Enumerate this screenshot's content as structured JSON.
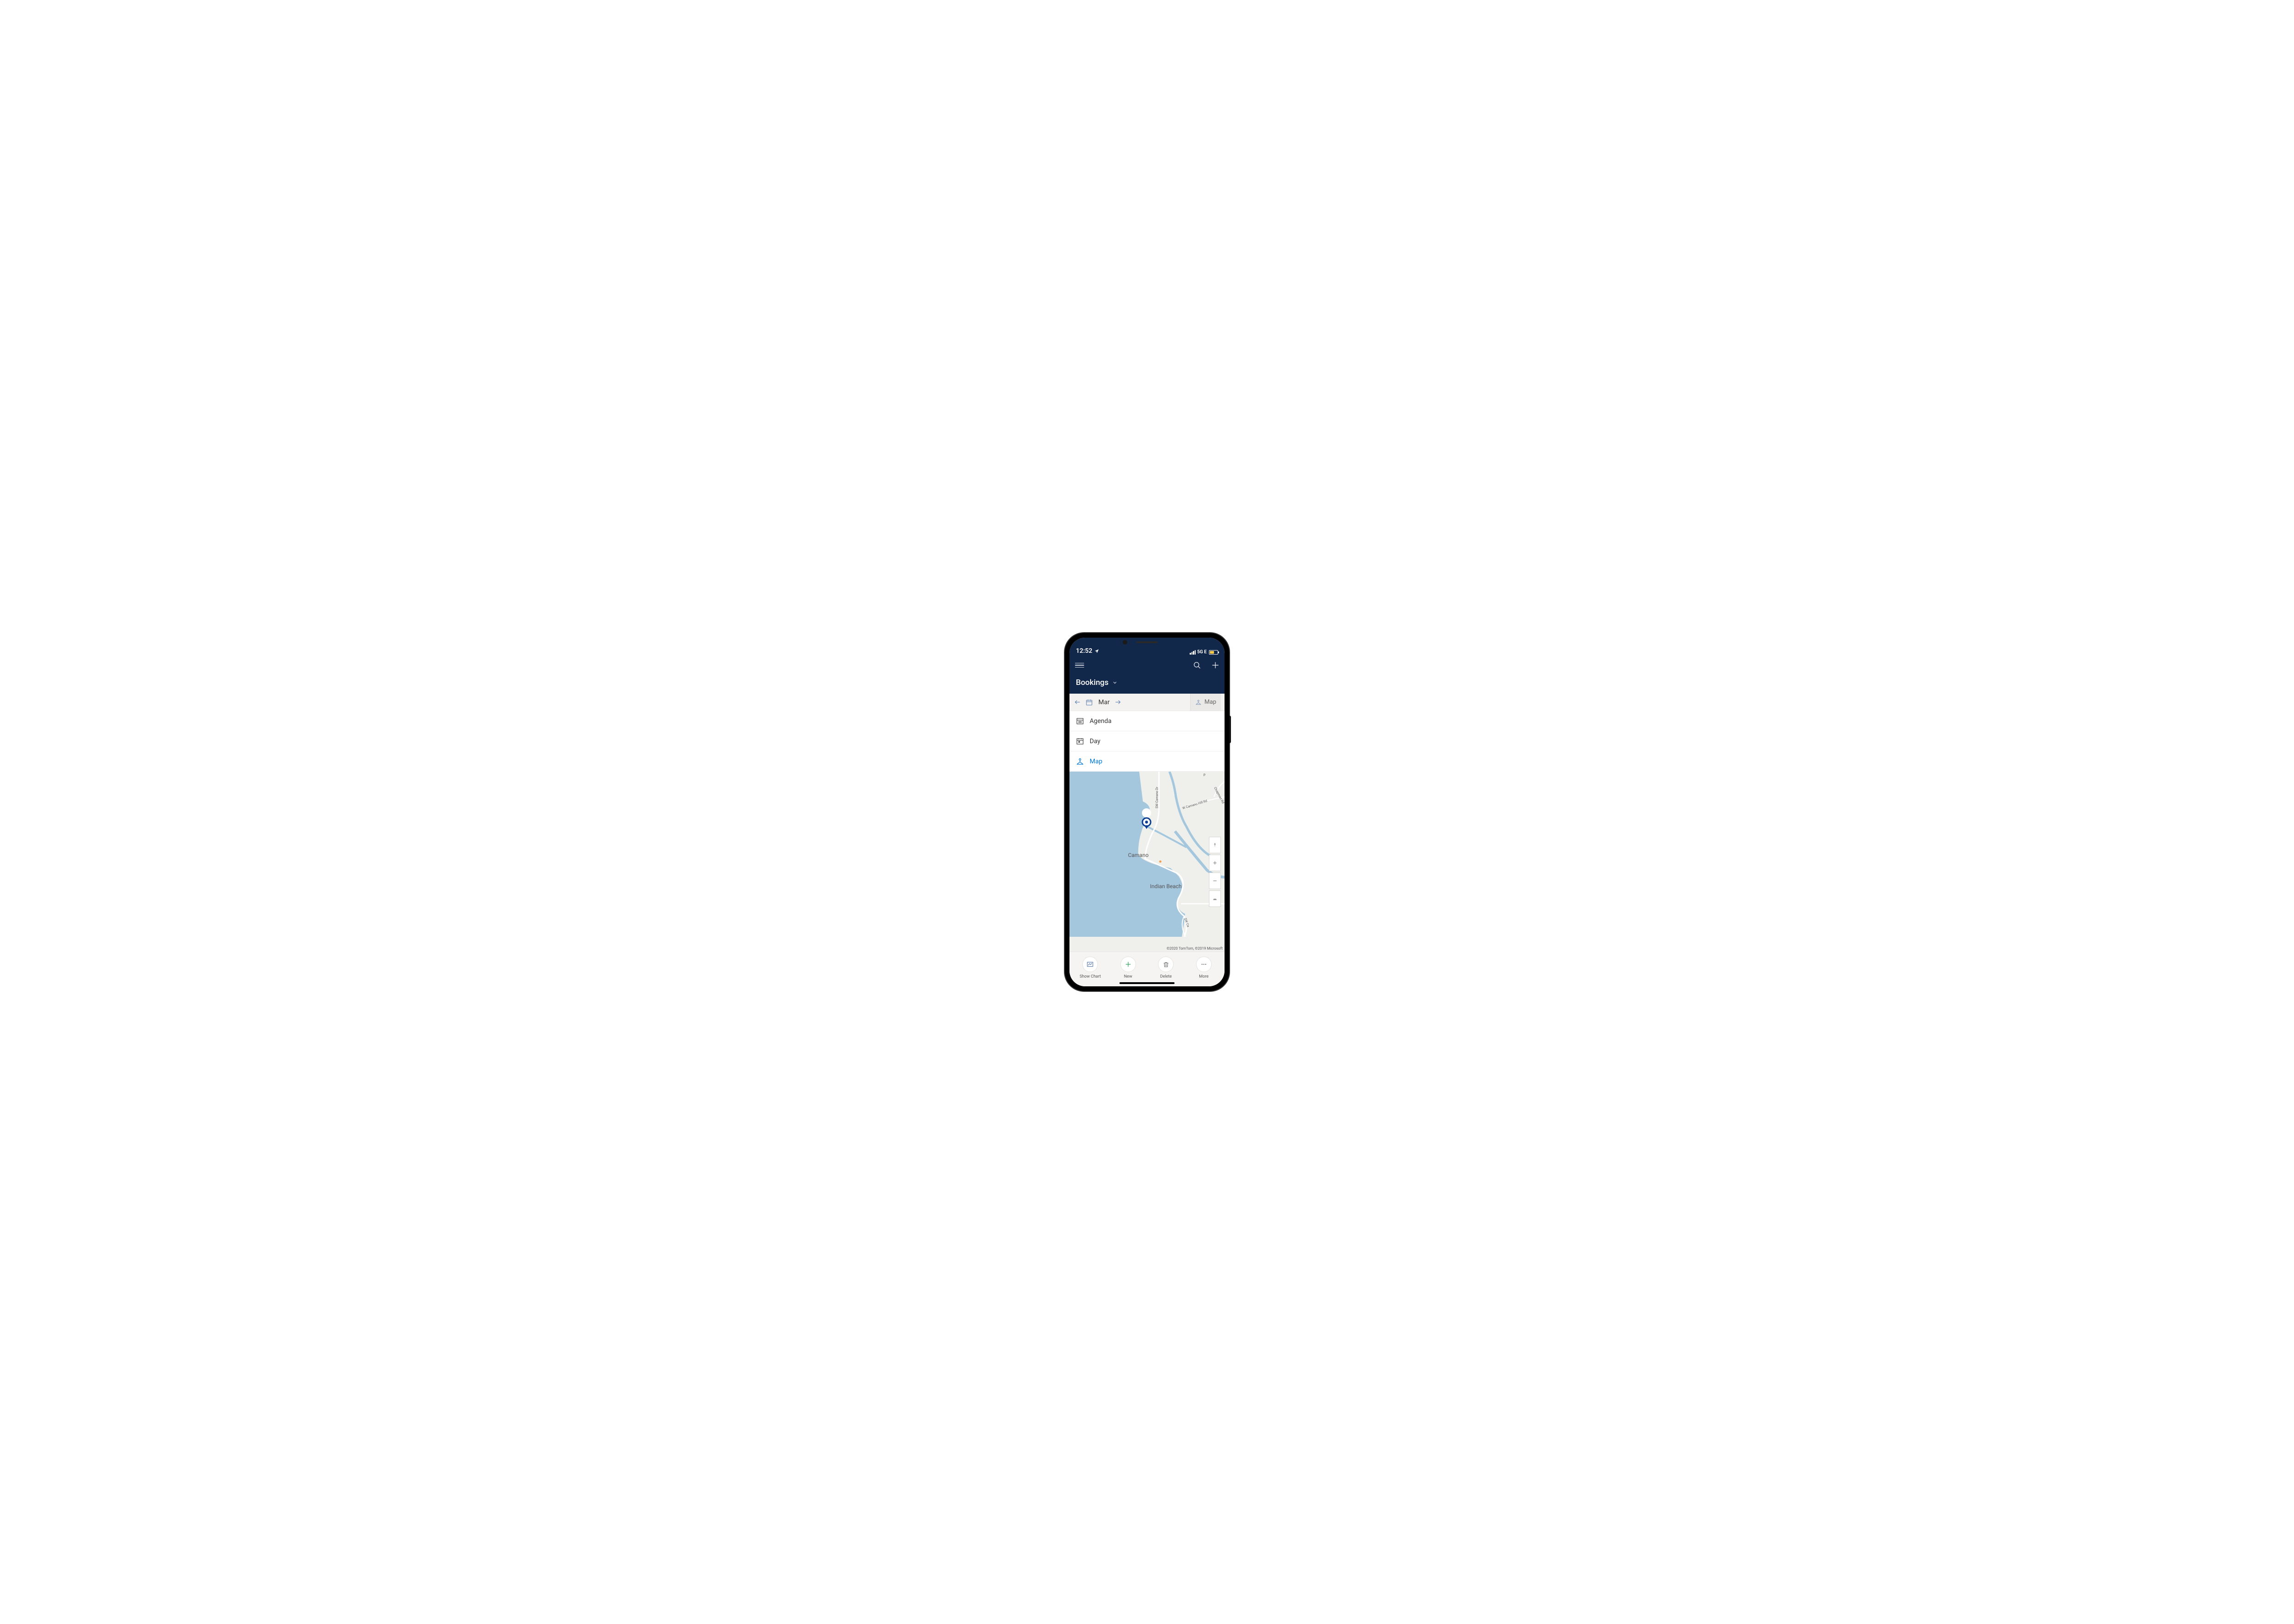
{
  "status": {
    "time": "12:52",
    "network": "5G E"
  },
  "header": {
    "title": "Bookings"
  },
  "datebar": {
    "month": "Mar",
    "view": "Map"
  },
  "dropdown": {
    "agenda": "Agenda",
    "day": "Day",
    "map": "Map"
  },
  "map": {
    "places": {
      "camano": "Camano",
      "indian_beach": "Indian Beach",
      "w_mo": "W Mo"
    },
    "roads": {
      "sw_camano_dr": "SW Camano Dr",
      "w_camano_hill": "W Camano Hill Rd",
      "chr": "Chapman Rd",
      "sw_ca": "SW Ca",
      "p": "P"
    },
    "attribution": "©2020 TomTom, ©2019 Microsoft"
  },
  "bottom": {
    "show_chart": "Show Chart",
    "new": "New",
    "delete": "Delete",
    "more": "More"
  }
}
